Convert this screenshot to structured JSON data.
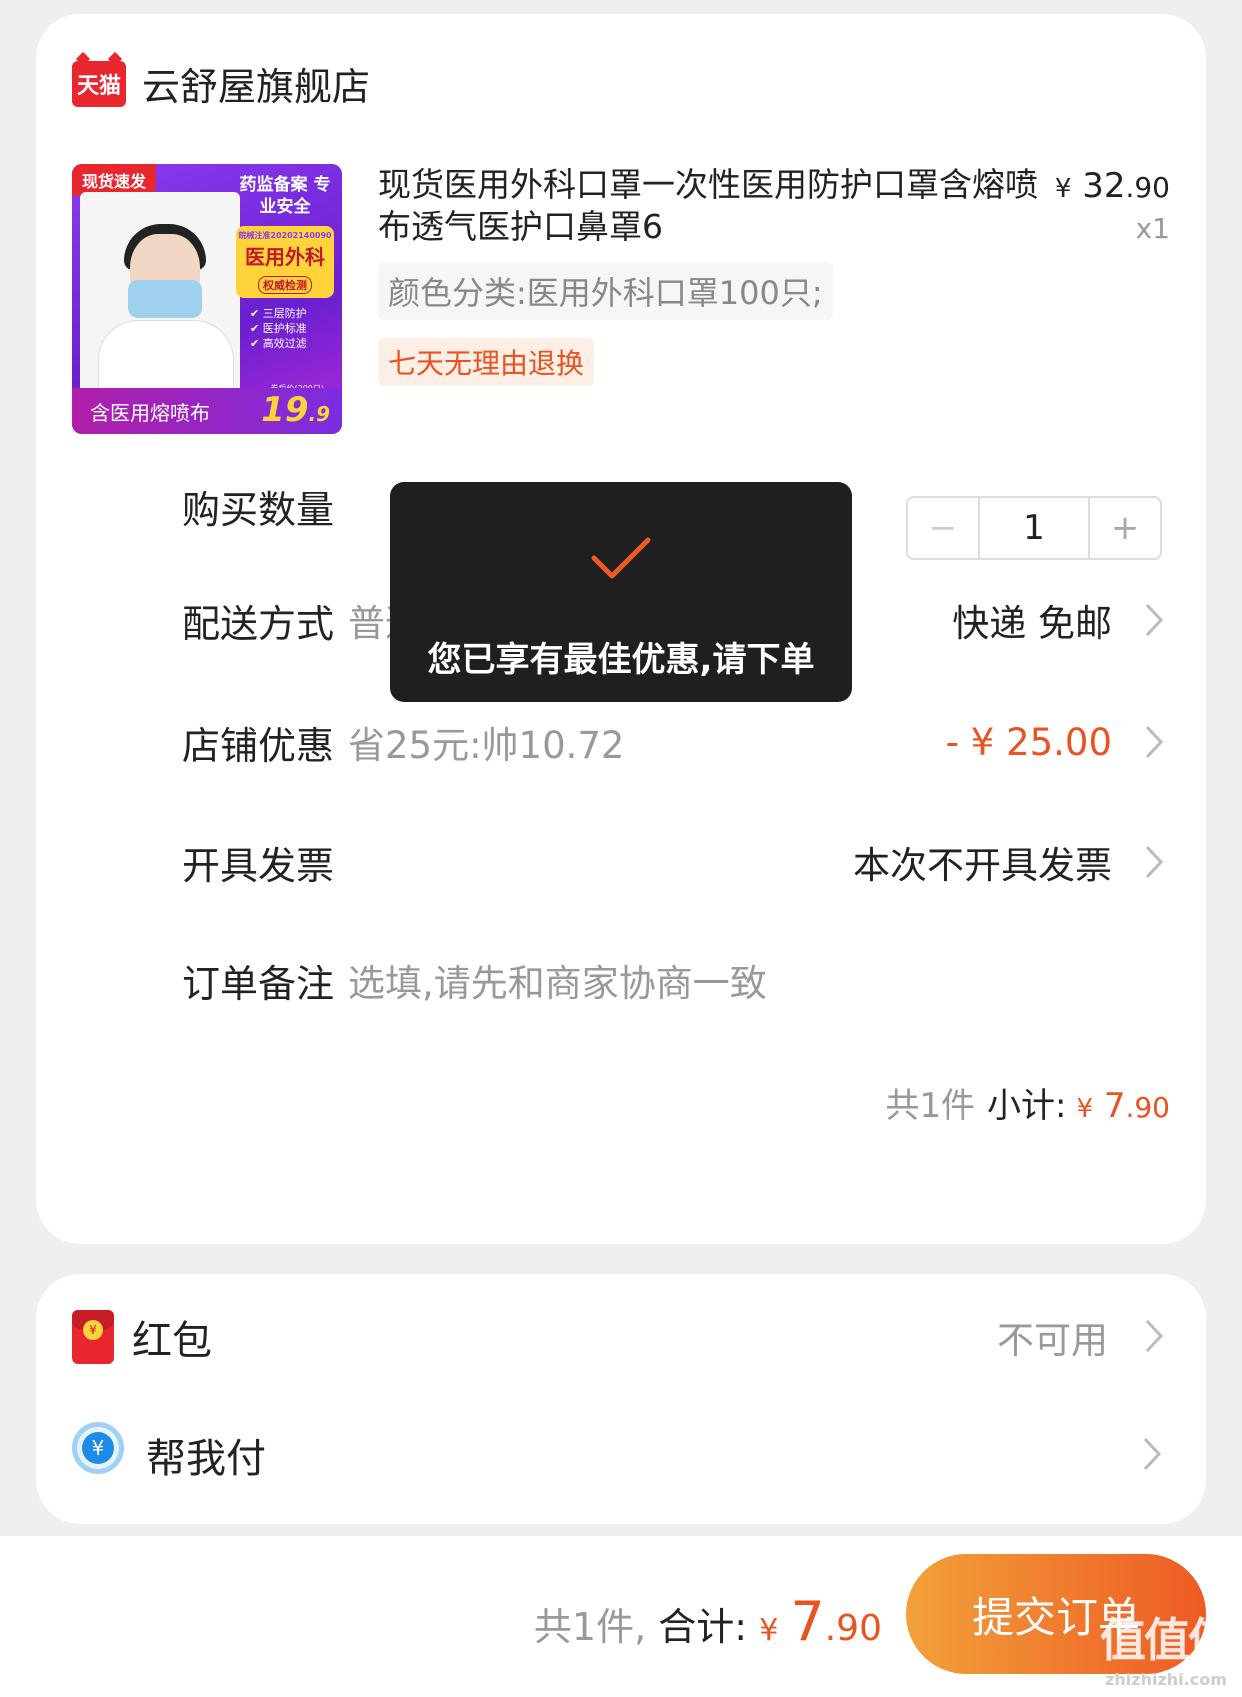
{
  "shop": {
    "badge": "天猫",
    "name": "云舒屋旗舰店"
  },
  "product": {
    "image": {
      "corner_tag": "现货速发",
      "side_title": "药监备案 专业安全",
      "registration": "皖械注准20202140090",
      "badge_main": "医用外科",
      "badge_sub": "权威检测",
      "checks": [
        "三层防护",
        "医护标准",
        "高效过滤"
      ],
      "bottom_text": "含医用熔喷布",
      "price_note": "券后价(200只)",
      "price_int": "19",
      "price_dec": ".9"
    },
    "title": "现货医用外科口罩一次性医用防护口罩含熔喷布透气医护口鼻罩6",
    "price_symbol": "¥",
    "price_int": "32",
    "price_cents": ".90",
    "quantity_label": "x1",
    "sku": "颜色分类:医用外科口罩100只;",
    "return_tag": "七天无理由退换"
  },
  "rows": {
    "quantity": {
      "label": "购买数量",
      "value": "1",
      "minus": "−",
      "plus": "+"
    },
    "delivery": {
      "label": "配送方式",
      "mid": "普通配送",
      "right": "快递 免邮"
    },
    "discount": {
      "label": "店铺优惠",
      "mid": "省25元:帅10.72",
      "right": "- ¥ 25.00"
    },
    "invoice": {
      "label": "开具发票",
      "right": "本次不开具发票"
    },
    "note": {
      "label": "订单备注",
      "placeholder": "选填,请先和商家协商一致"
    }
  },
  "subtotal": {
    "count": "共1件",
    "label": "小计:",
    "symbol": "¥",
    "int": "7",
    "cents": ".90"
  },
  "toast": {
    "message": "您已享有最佳优惠,请下单"
  },
  "extras": {
    "redpack": {
      "label": "红包",
      "right": "不可用"
    },
    "helppay": {
      "label": "帮我付"
    }
  },
  "footer": {
    "count": "共1件,",
    "label": "合计:",
    "symbol": "¥",
    "int": "7",
    "cents": ".90",
    "submit": "提交订单",
    "watermark": "值值值",
    "watermark_sub": "zhizhizhi.com"
  },
  "colors": {
    "accent": "#e8531f",
    "tmall_red": "#e8262d",
    "toast_bg": "#1f1f1f"
  }
}
